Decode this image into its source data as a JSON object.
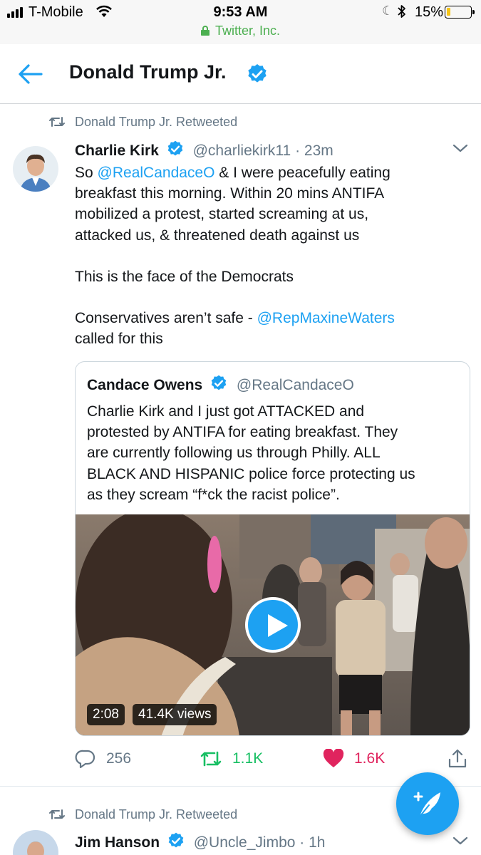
{
  "status_bar": {
    "carrier": "T-Mobile",
    "time": "9:53 AM",
    "site": "Twitter, Inc.",
    "battery_pct": "15%",
    "battery_level": 0.15
  },
  "header": {
    "title": "Donald Trump Jr."
  },
  "tweet1": {
    "retweet_label": "Donald Trump Jr. Retweeted",
    "name": "Charlie Kirk",
    "handle": "@charliekirk11",
    "time": "· 23m",
    "body": {
      "line1_pre": "So ",
      "line1_mention": "@RealCandaceO",
      "line1_post": " & I were peacefully eating",
      "line2": "breakfast this morning. Within 20 mins ANTIFA",
      "line3": "mobilized a protest, started screaming at us,",
      "line4": "attacked us, & threatened death against us",
      "para2": "This is the face of the Democrats",
      "para3_pre": "Conservatives aren’t safe  - ",
      "para3_mention": "@RepMaxineWaters",
      "para3_post": "called for this"
    },
    "quote": {
      "name": "Candace Owens",
      "handle": "@RealCandaceO",
      "lines": [
        "Charlie Kirk and I just got ATTACKED and",
        "protested by ANTIFA for eating breakfast. They",
        "are currently following us through Philly. ALL",
        "BLACK AND HISPANIC police force protecting us",
        "as they scream “f*ck the racist police”."
      ],
      "video_duration": "2:08",
      "video_views": "41.4K views"
    },
    "actions": {
      "replies": "256",
      "retweets": "1.1K",
      "likes": "1.6K"
    }
  },
  "tweet2": {
    "retweet_label": "Donald Trump Jr. Retweeted",
    "name": "Jim Hanson",
    "handle": "@Uncle_Jimbo",
    "time": "· 1h"
  },
  "colors": {
    "accent": "#1da1f2",
    "retweet_green": "#17bf63",
    "like_red": "#e0245e",
    "secure_green": "#4caf50",
    "muted": "#657786"
  }
}
